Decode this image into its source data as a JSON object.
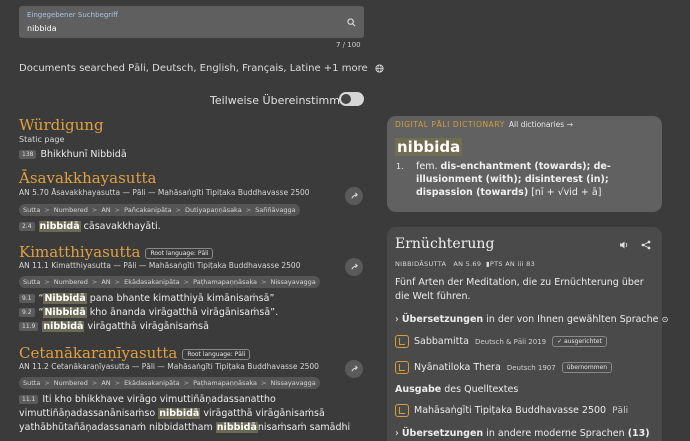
{
  "search": {
    "label": "Eingegebener Suchbegriff",
    "value": "nibbida",
    "counter": "7 / 100"
  },
  "docs_searched": "Documents searched Pāli, Deutsch, English, Français, Latine +1 more",
  "partial_match": "Teilweise Übereinstimmung",
  "results": [
    {
      "title": "Würdigung",
      "sub": "Static page",
      "lines": [
        {
          "num": "138",
          "text": "Bhikkhunī Nibbidā"
        }
      ]
    },
    {
      "title": "Āsavakkhayasutta",
      "ref": "AN 5.70 Āsavakkhayasutta — Pāli — Mahāsaṅgīti Tipiṭaka Buddhavasse 2500",
      "crumbs": [
        "Sutta",
        "Numbered",
        "AN",
        "Pañcakanipāta",
        "Dutiyapaṇṇāsaka",
        "Saññāvagga"
      ],
      "lines": [
        {
          "num": "2.4",
          "hl": "nibbidā",
          "text": "cāsavakkhayāti."
        }
      ]
    },
    {
      "title": "Kimatthiyasutta",
      "badge": "Root language: Pāli",
      "ref": "AN 11.1 Kimatthiyasutta — Pāli — Mahāsaṅgīti Tipiṭaka Buddhavasse 2500",
      "crumbs": [
        "Sutta",
        "Numbered",
        "AN",
        "Ekādasakanipāta",
        "Paṭhamapaṇṇāsaka",
        "Nissayavagga"
      ],
      "lines": [
        {
          "num": "9.1",
          "pre": "“",
          "hl": "Nibbidā",
          "text": "pana bhante kimatthiyā kimānisaṁsā”"
        },
        {
          "num": "9.2",
          "pre": "“",
          "hl": "Nibbidā",
          "text": "kho ānanda virāgatthā virāgānisaṁsā”."
        },
        {
          "num": "11.9",
          "hl": "nibbidā",
          "text": "virāgatthā virāgānisaṁsā"
        }
      ]
    },
    {
      "title": "Cetanākaraṇīyasutta",
      "badge": "Root language: Pāli",
      "ref": "AN 11.2 Cetanākaraṇīyasutta — Pāli — Mahāsaṅgīti Tipiṭaka Buddhavasse 2500",
      "crumbs": [
        "Sutta",
        "Numbered",
        "AN",
        "Ekādasakanipāta",
        "Paṭhamapaṇṇāsaka",
        "Nissayavagga"
      ],
      "lines": [
        {
          "num": "11.1",
          "text": "Iti kho bhikkhave virāgo vimuttiñāṇadassanattho"
        },
        {
          "text": "vimuttiñāṇadassanānisaṁso",
          "hl": "nibbidā",
          "post": "virāgatthā virāgānisaṁsā"
        },
        {
          "text": "yathābhūtañāṇadassanaṁ nibbidattham",
          "hl": "nibbidā",
          "post": "nisaṁsaṁ samādhi"
        }
      ]
    }
  ],
  "dpd": {
    "title": "DIGITAL PĀLI DICTIONARY",
    "all_link": "All dictionaries →",
    "word": "nibbida",
    "def_num": "1.",
    "def_gender": "fem.",
    "def_text": "dis-enchantment (towards); de-illusionment (with); disinterest (in); dispassion (towards)",
    "def_etym": "[nī + √vid + ā]"
  },
  "ern": {
    "title": "Ernüchterung",
    "meta_left": "NIBBIDĀSUTTA",
    "meta_ref": "AN 5.69",
    "meta_pts": "PTS AN iii 83",
    "desc": "Fünf Arten der Meditation, die zu Ernüchterung über die Welt führen.",
    "trans_bold": "Übersetzungen",
    "trans_rest": "in der von Ihnen gewählten Sprache",
    "t1_name": "Sabbamitta",
    "t1_meta": "Deutsch & Pāli 2019",
    "t1_pill": "✓ ausgerichtet",
    "t2_name": "Nyānatiloka Thera",
    "t2_meta": "Deutsch 1907",
    "t2_pill": "übernommen",
    "ausgabe_bold": "Ausgabe",
    "ausgabe_rest": "des Quelltextes",
    "edition_name": "Mahāsaṅgīti Tipiṭaka Buddhavasse 2500",
    "edition_lang": "Pāli",
    "more_bold": "Übersetzungen",
    "more_rest": "in andere moderne Sprachen",
    "more_count": "(13)"
  }
}
